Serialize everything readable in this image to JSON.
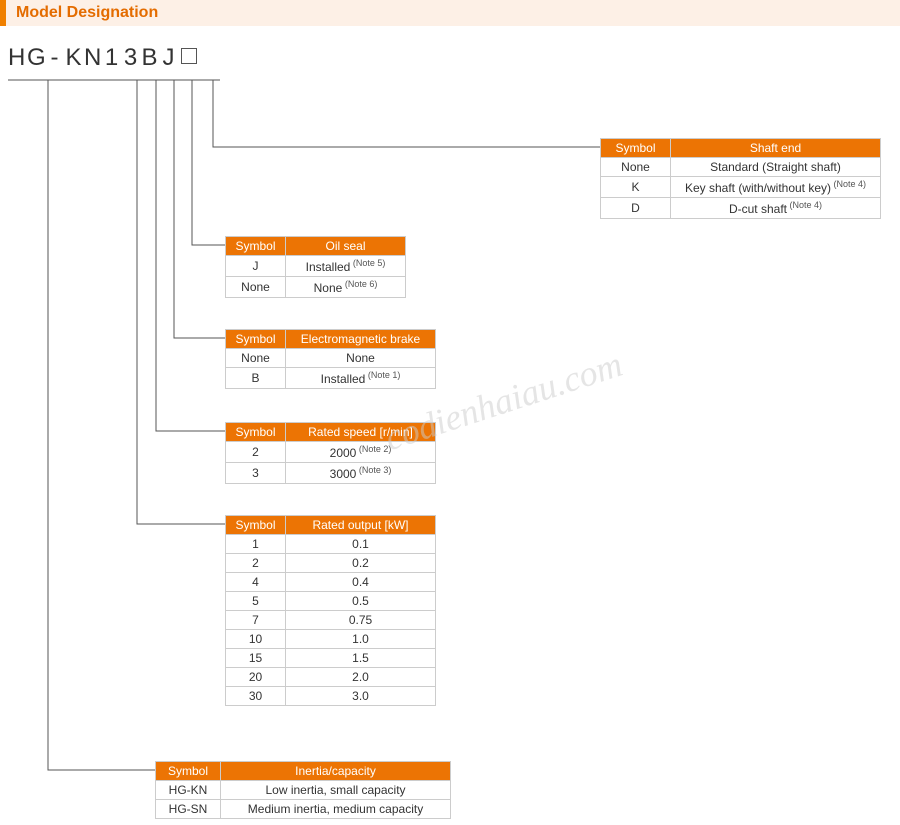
{
  "title": "Model Designation",
  "model_chars": [
    "H",
    "G",
    "-",
    "K",
    "N",
    "1",
    "3",
    "B",
    "J"
  ],
  "watermark": "codienhaiau.com",
  "tables": {
    "shaft_end": {
      "headers": [
        "Symbol",
        "Shaft end"
      ],
      "rows": [
        {
          "sym": "None",
          "val": "Standard (Straight shaft)",
          "note": ""
        },
        {
          "sym": "K",
          "val": "Key shaft (with/without key)",
          "note": "(Note 4)"
        },
        {
          "sym": "D",
          "val": "D-cut shaft",
          "note": "(Note 4)"
        }
      ]
    },
    "oil_seal": {
      "headers": [
        "Symbol",
        "Oil seal"
      ],
      "rows": [
        {
          "sym": "J",
          "val": "Installed",
          "note": "(Note 5)"
        },
        {
          "sym": "None",
          "val": "None",
          "note": "(Note 6)"
        }
      ]
    },
    "brake": {
      "headers": [
        "Symbol",
        "Electromagnetic brake"
      ],
      "rows": [
        {
          "sym": "None",
          "val": "None",
          "note": ""
        },
        {
          "sym": "B",
          "val": "Installed",
          "note": "(Note 1)"
        }
      ]
    },
    "rated_speed": {
      "headers": [
        "Symbol",
        "Rated speed [r/min]"
      ],
      "rows": [
        {
          "sym": "2",
          "val": "2000",
          "note": "(Note 2)"
        },
        {
          "sym": "3",
          "val": "3000",
          "note": "(Note 3)"
        }
      ]
    },
    "rated_output": {
      "headers": [
        "Symbol",
        "Rated output [kW]"
      ],
      "rows": [
        {
          "sym": "1",
          "val": "0.1",
          "note": ""
        },
        {
          "sym": "2",
          "val": "0.2",
          "note": ""
        },
        {
          "sym": "4",
          "val": "0.4",
          "note": ""
        },
        {
          "sym": "5",
          "val": "0.5",
          "note": ""
        },
        {
          "sym": "7",
          "val": "0.75",
          "note": ""
        },
        {
          "sym": "10",
          "val": "1.0",
          "note": ""
        },
        {
          "sym": "15",
          "val": "1.5",
          "note": ""
        },
        {
          "sym": "20",
          "val": "2.0",
          "note": ""
        },
        {
          "sym": "30",
          "val": "3.0",
          "note": ""
        }
      ]
    },
    "inertia": {
      "headers": [
        "Symbol",
        "Inertia/capacity"
      ],
      "rows": [
        {
          "sym": "HG-KN",
          "val": "Low inertia, small capacity",
          "note": ""
        },
        {
          "sym": "HG-SN",
          "val": "Medium inertia, medium capacity",
          "note": ""
        }
      ]
    }
  }
}
